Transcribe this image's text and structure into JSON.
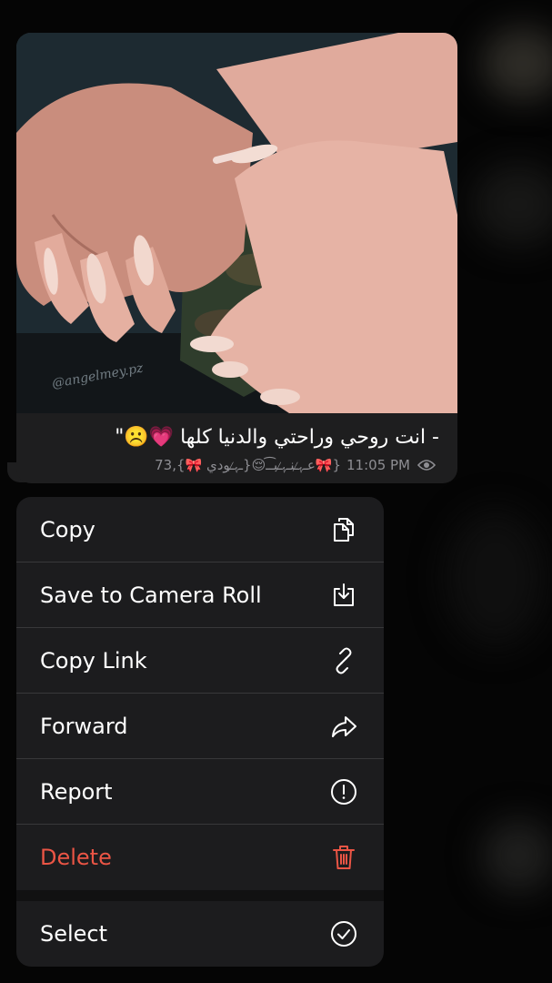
{
  "message": {
    "caption": "- انت روحي وراحتي والدنيا كلها 💗☹️\"",
    "views": "73",
    "signature": "{🎀عـﮩ̷̷ـنـﮩ̷̷ـبـ͡ـ😌{ـﮩ̷̷ـودي 🎀},",
    "time": "11:05 PM",
    "watermark": "@angelmey.pz"
  },
  "menu": {
    "items": [
      {
        "label": "Copy",
        "icon": "copy-icon"
      },
      {
        "label": "Save to Camera Roll",
        "icon": "download-icon"
      },
      {
        "label": "Copy Link",
        "icon": "link-icon"
      },
      {
        "label": "Forward",
        "icon": "forward-icon"
      },
      {
        "label": "Report",
        "icon": "report-icon"
      },
      {
        "label": "Delete",
        "icon": "trash-icon"
      },
      {
        "label": "Select",
        "icon": "checkmark-circle-icon"
      }
    ]
  },
  "colors": {
    "background": "#050505",
    "bubble": "#1e1e1f",
    "menu": "#1c1c1e",
    "danger": "#eb5545",
    "meta": "#8e8e93"
  }
}
